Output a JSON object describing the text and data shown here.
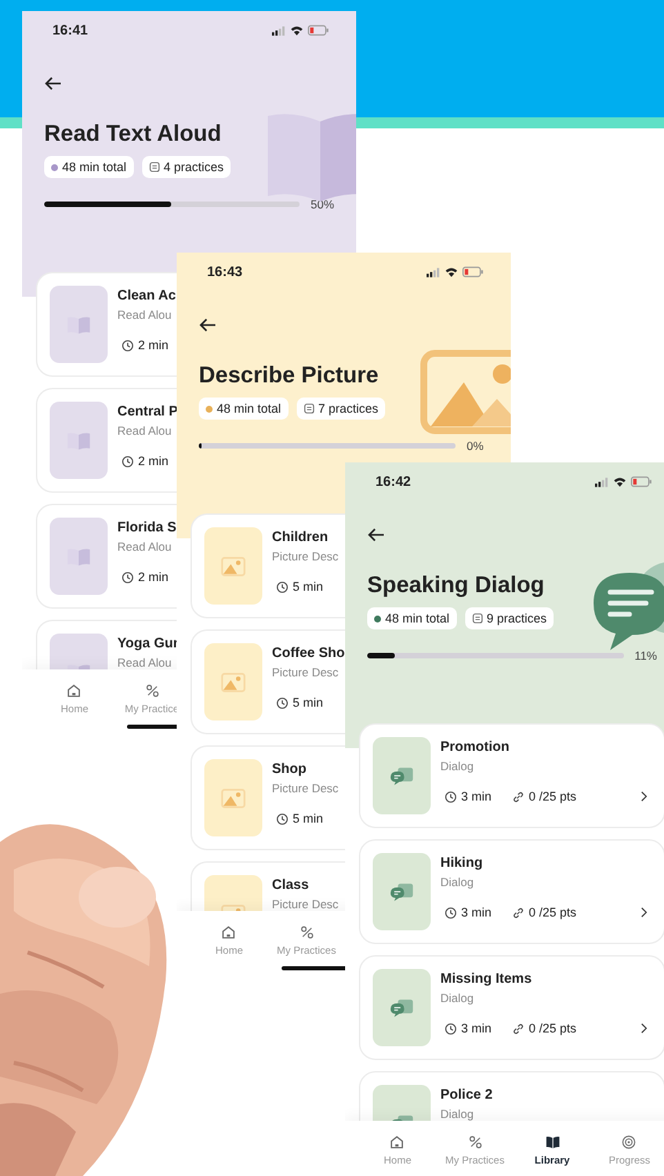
{
  "screens": [
    {
      "kind": "read",
      "time": "16:41",
      "title": "Read Text Aloud",
      "total": "48 min total",
      "practices": "4 practices",
      "progress": {
        "level": 0.5,
        "reading": "50%"
      },
      "items": [
        {
          "title": "Clean Ac",
          "subtitle": "Read Alou",
          "duration": "2 min"
        },
        {
          "title": "Central P",
          "subtitle": "Read Alou",
          "duration": "2 min"
        },
        {
          "title": "Florida S",
          "subtitle": "Read Alou",
          "duration": "2 min"
        },
        {
          "title": "Yoga Gur",
          "subtitle": "Read Alou"
        }
      ],
      "nav": [
        {
          "kind": "home",
          "label": "Home",
          "selected": false
        },
        {
          "kind": "practices",
          "label": "My Practice",
          "selected": false
        }
      ]
    },
    {
      "kind": "picture",
      "time": "16:43",
      "title": "Describe Picture",
      "total": "48 min total",
      "practices": "7 practices",
      "progress": {
        "level": 0,
        "reading": "0%"
      },
      "items": [
        {
          "title": "Children",
          "subtitle": "Picture Desc",
          "duration": "5 min"
        },
        {
          "title": "Coffee Sho",
          "subtitle": "Picture Desc",
          "duration": "5 min"
        },
        {
          "title": "Shop",
          "subtitle": "Picture Desc",
          "duration": "5 min"
        },
        {
          "title": "Class",
          "subtitle": "Picture Desc"
        }
      ],
      "nav": [
        {
          "kind": "home",
          "label": "Home",
          "selected": false
        },
        {
          "kind": "practices",
          "label": "My Practices",
          "selected": false
        }
      ]
    },
    {
      "kind": "dialog",
      "time": "16:42",
      "title": "Speaking Dialog",
      "total": "48 min total",
      "practices": "9 practices",
      "progress": {
        "level": 0.11,
        "reading": "11%"
      },
      "items": [
        {
          "title": "Promotion",
          "subtitle": "Dialog",
          "duration": "3 min",
          "points": "0 /25 pts"
        },
        {
          "title": "Hiking",
          "subtitle": "Dialog",
          "duration": "3 min",
          "points": "0 /25 pts"
        },
        {
          "title": "Missing Items",
          "subtitle": "Dialog",
          "duration": "3 min",
          "points": "0 /25 pts"
        },
        {
          "title": "Police 2",
          "subtitle": "Dialog"
        }
      ],
      "nav": [
        {
          "kind": "home",
          "label": "Home",
          "selected": false
        },
        {
          "kind": "practices",
          "label": "My Practices",
          "selected": false
        },
        {
          "kind": "library",
          "label": "Library",
          "selected": true
        },
        {
          "kind": "progress",
          "label": "Progress",
          "selected": false
        }
      ]
    }
  ]
}
